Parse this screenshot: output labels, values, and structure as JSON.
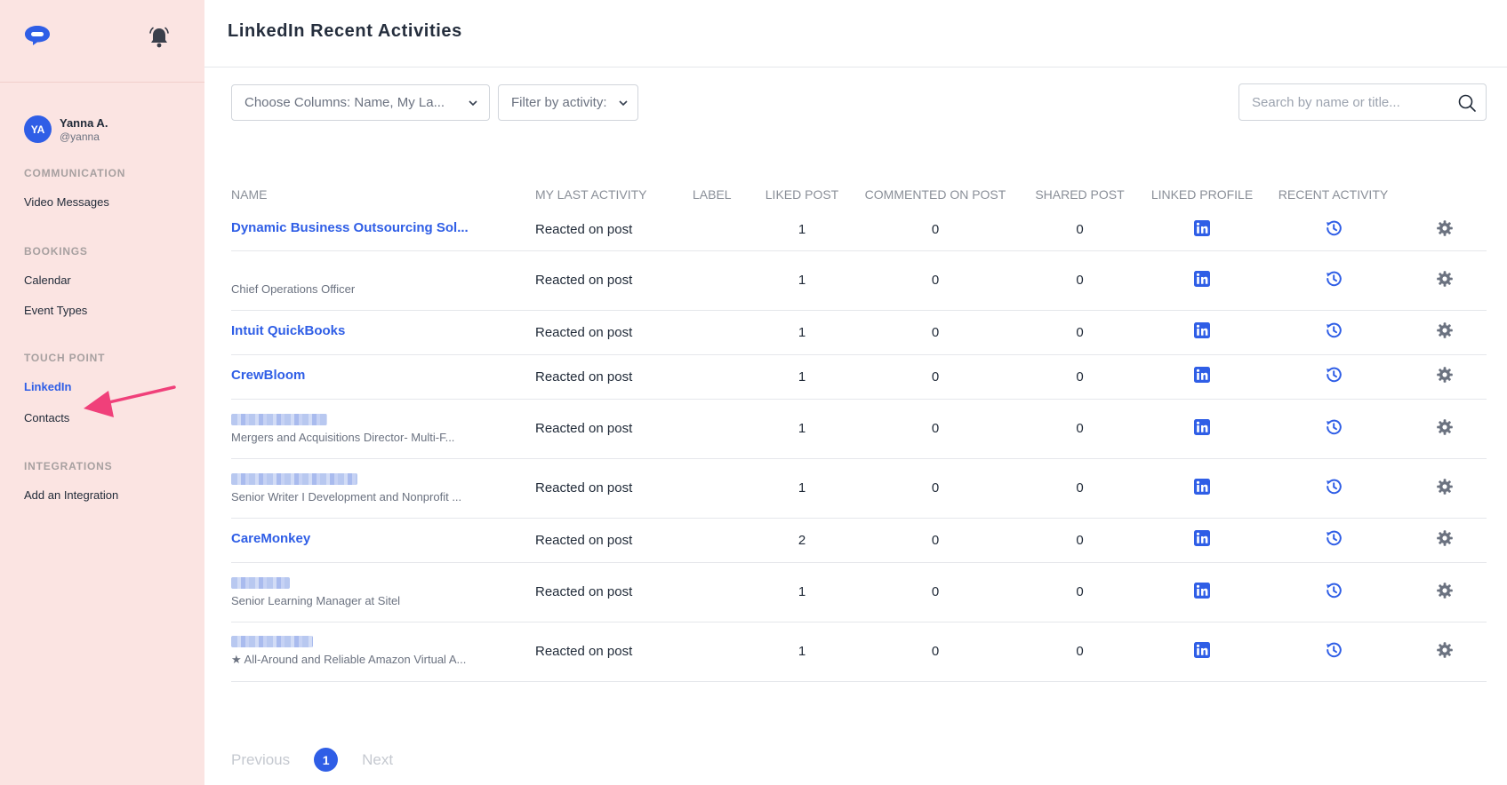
{
  "sidebar": {
    "user": {
      "initials": "YA",
      "name": "Yanna A.",
      "handle": "@yanna"
    },
    "sections": [
      {
        "title": "COMMUNICATION",
        "items": [
          "Video Messages"
        ]
      },
      {
        "title": "BOOKINGS",
        "items": [
          "Calendar",
          "Event Types"
        ]
      },
      {
        "title": "TOUCH POINT",
        "items": [
          "LinkedIn",
          "Contacts"
        ]
      },
      {
        "title": "INTEGRATIONS",
        "items": [
          "Add an Integration"
        ]
      }
    ],
    "active_item": "LinkedIn"
  },
  "header": {
    "title": "LinkedIn Recent Activities"
  },
  "toolbar": {
    "columns_select": "Choose Columns: Name,  My La...",
    "activity_filter": "Filter by activity:",
    "search_placeholder": "Search by name or title..."
  },
  "table": {
    "columns": [
      "NAME",
      "MY LAST ACTIVITY",
      "LABEL",
      "LIKED POST",
      "COMMENTED ON POST",
      "SHARED POST",
      "LINKED PROFILE",
      "RECENT ACTIVITY"
    ],
    "rows": [
      {
        "name": "Dynamic Business Outsourcing Sol...",
        "subtitle": "",
        "activity": "Reacted on post",
        "label": "",
        "liked": "1",
        "commented": "0",
        "shared": "0"
      },
      {
        "name": "",
        "subtitle": "Chief Operations Officer",
        "activity": "Reacted on post",
        "label": "",
        "liked": "1",
        "commented": "0",
        "shared": "0"
      },
      {
        "name": "Intuit QuickBooks",
        "subtitle": "",
        "activity": "Reacted on post",
        "label": "",
        "liked": "1",
        "commented": "0",
        "shared": "0"
      },
      {
        "name": "CrewBloom",
        "subtitle": "",
        "activity": "Reacted on post",
        "label": "",
        "liked": "1",
        "commented": "0",
        "shared": "0"
      },
      {
        "name": "",
        "subtitle": "Mergers and Acquisitions Director- Multi-F...",
        "activity": "Reacted on post",
        "label": "",
        "liked": "1",
        "commented": "0",
        "shared": "0"
      },
      {
        "name": "",
        "subtitle": "Senior Writer I Development and Nonprofit ...",
        "activity": "Reacted on post",
        "label": "",
        "liked": "1",
        "commented": "0",
        "shared": "0"
      },
      {
        "name": "CareMonkey",
        "subtitle": "",
        "activity": "Reacted on post",
        "label": "",
        "liked": "2",
        "commented": "0",
        "shared": "0"
      },
      {
        "name": "",
        "subtitle": "Senior Learning Manager at Sitel",
        "activity": "Reacted on post",
        "label": "",
        "liked": "1",
        "commented": "0",
        "shared": "0"
      },
      {
        "name": "",
        "subtitle": "★ All-Around and Reliable Amazon Virtual A...",
        "activity": "Reacted on post",
        "label": "",
        "liked": "1",
        "commented": "0",
        "shared": "0"
      }
    ]
  },
  "pagination": {
    "previous": "Previous",
    "current": "1",
    "next": "Next"
  },
  "colors": {
    "accent": "#2f5ee6",
    "sidebar_bg": "#fbe4e2",
    "arrow": "#f0407a"
  },
  "icons": {
    "logo": "chat-bubble-logo",
    "bell": "bell-icon",
    "linkedin": "linkedin-icon",
    "history": "history-icon",
    "settings": "gear-icon",
    "search": "search-icon"
  }
}
